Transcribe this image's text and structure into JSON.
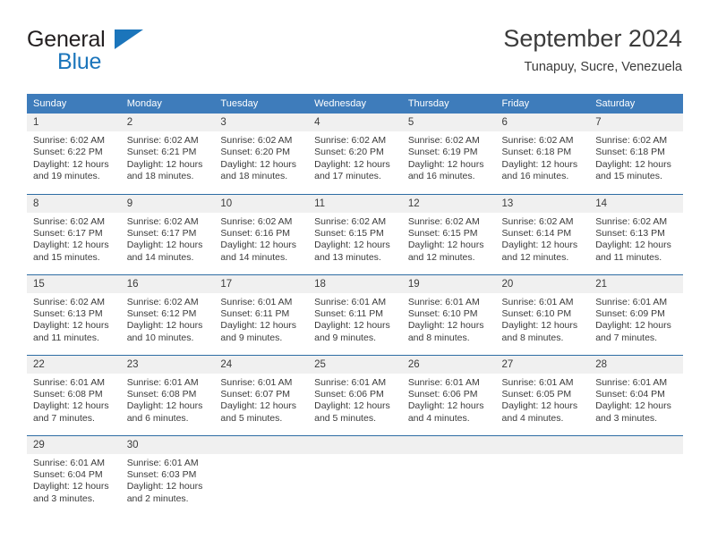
{
  "brand": {
    "line1": "General",
    "line2": "Blue",
    "triangle_icon": "blue-triangle-icon",
    "color_dark": "#231f20",
    "color_blue": "#1b75bb"
  },
  "header": {
    "title": "September 2024",
    "subtitle": "Tunapuy, Sucre, Venezuela"
  },
  "colors": {
    "header_bg": "#3e7cbb",
    "row_divider": "#2e6da4",
    "daynum_bg": "#f0f0f0",
    "text": "#3b3b3b"
  },
  "weekday_headers": [
    "Sunday",
    "Monday",
    "Tuesday",
    "Wednesday",
    "Thursday",
    "Friday",
    "Saturday"
  ],
  "weeks": [
    [
      {
        "day": "1",
        "lines": "Sunrise: 6:02 AM\nSunset: 6:22 PM\nDaylight: 12 hours\nand 19 minutes."
      },
      {
        "day": "2",
        "lines": "Sunrise: 6:02 AM\nSunset: 6:21 PM\nDaylight: 12 hours\nand 18 minutes."
      },
      {
        "day": "3",
        "lines": "Sunrise: 6:02 AM\nSunset: 6:20 PM\nDaylight: 12 hours\nand 18 minutes."
      },
      {
        "day": "4",
        "lines": "Sunrise: 6:02 AM\nSunset: 6:20 PM\nDaylight: 12 hours\nand 17 minutes."
      },
      {
        "day": "5",
        "lines": "Sunrise: 6:02 AM\nSunset: 6:19 PM\nDaylight: 12 hours\nand 16 minutes."
      },
      {
        "day": "6",
        "lines": "Sunrise: 6:02 AM\nSunset: 6:18 PM\nDaylight: 12 hours\nand 16 minutes."
      },
      {
        "day": "7",
        "lines": "Sunrise: 6:02 AM\nSunset: 6:18 PM\nDaylight: 12 hours\nand 15 minutes."
      }
    ],
    [
      {
        "day": "8",
        "lines": "Sunrise: 6:02 AM\nSunset: 6:17 PM\nDaylight: 12 hours\nand 15 minutes."
      },
      {
        "day": "9",
        "lines": "Sunrise: 6:02 AM\nSunset: 6:17 PM\nDaylight: 12 hours\nand 14 minutes."
      },
      {
        "day": "10",
        "lines": "Sunrise: 6:02 AM\nSunset: 6:16 PM\nDaylight: 12 hours\nand 14 minutes."
      },
      {
        "day": "11",
        "lines": "Sunrise: 6:02 AM\nSunset: 6:15 PM\nDaylight: 12 hours\nand 13 minutes."
      },
      {
        "day": "12",
        "lines": "Sunrise: 6:02 AM\nSunset: 6:15 PM\nDaylight: 12 hours\nand 12 minutes."
      },
      {
        "day": "13",
        "lines": "Sunrise: 6:02 AM\nSunset: 6:14 PM\nDaylight: 12 hours\nand 12 minutes."
      },
      {
        "day": "14",
        "lines": "Sunrise: 6:02 AM\nSunset: 6:13 PM\nDaylight: 12 hours\nand 11 minutes."
      }
    ],
    [
      {
        "day": "15",
        "lines": "Sunrise: 6:02 AM\nSunset: 6:13 PM\nDaylight: 12 hours\nand 11 minutes."
      },
      {
        "day": "16",
        "lines": "Sunrise: 6:02 AM\nSunset: 6:12 PM\nDaylight: 12 hours\nand 10 minutes."
      },
      {
        "day": "17",
        "lines": "Sunrise: 6:01 AM\nSunset: 6:11 PM\nDaylight: 12 hours\nand 9 minutes."
      },
      {
        "day": "18",
        "lines": "Sunrise: 6:01 AM\nSunset: 6:11 PM\nDaylight: 12 hours\nand 9 minutes."
      },
      {
        "day": "19",
        "lines": "Sunrise: 6:01 AM\nSunset: 6:10 PM\nDaylight: 12 hours\nand 8 minutes."
      },
      {
        "day": "20",
        "lines": "Sunrise: 6:01 AM\nSunset: 6:10 PM\nDaylight: 12 hours\nand 8 minutes."
      },
      {
        "day": "21",
        "lines": "Sunrise: 6:01 AM\nSunset: 6:09 PM\nDaylight: 12 hours\nand 7 minutes."
      }
    ],
    [
      {
        "day": "22",
        "lines": "Sunrise: 6:01 AM\nSunset: 6:08 PM\nDaylight: 12 hours\nand 7 minutes."
      },
      {
        "day": "23",
        "lines": "Sunrise: 6:01 AM\nSunset: 6:08 PM\nDaylight: 12 hours\nand 6 minutes."
      },
      {
        "day": "24",
        "lines": "Sunrise: 6:01 AM\nSunset: 6:07 PM\nDaylight: 12 hours\nand 5 minutes."
      },
      {
        "day": "25",
        "lines": "Sunrise: 6:01 AM\nSunset: 6:06 PM\nDaylight: 12 hours\nand 5 minutes."
      },
      {
        "day": "26",
        "lines": "Sunrise: 6:01 AM\nSunset: 6:06 PM\nDaylight: 12 hours\nand 4 minutes."
      },
      {
        "day": "27",
        "lines": "Sunrise: 6:01 AM\nSunset: 6:05 PM\nDaylight: 12 hours\nand 4 minutes."
      },
      {
        "day": "28",
        "lines": "Sunrise: 6:01 AM\nSunset: 6:04 PM\nDaylight: 12 hours\nand 3 minutes."
      }
    ],
    [
      {
        "day": "29",
        "lines": "Sunrise: 6:01 AM\nSunset: 6:04 PM\nDaylight: 12 hours\nand 3 minutes."
      },
      {
        "day": "30",
        "lines": "Sunrise: 6:01 AM\nSunset: 6:03 PM\nDaylight: 12 hours\nand 2 minutes."
      },
      {
        "day": "",
        "lines": ""
      },
      {
        "day": "",
        "lines": ""
      },
      {
        "day": "",
        "lines": ""
      },
      {
        "day": "",
        "lines": ""
      },
      {
        "day": "",
        "lines": ""
      }
    ]
  ]
}
